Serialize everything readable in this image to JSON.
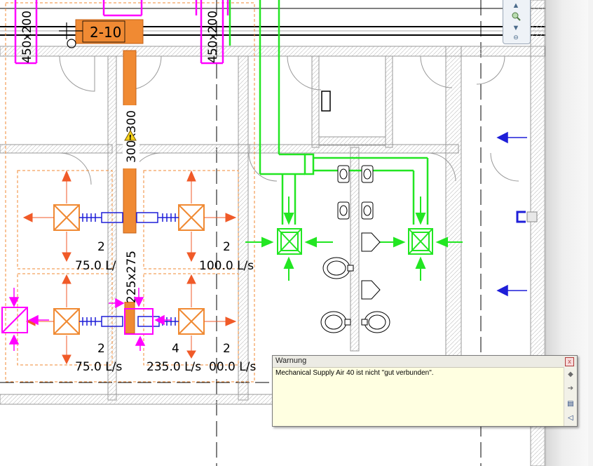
{
  "drawing": {
    "tag_room": "2-10",
    "duct_sizes": {
      "top_left": "450x200",
      "top_right": "450x200",
      "main_vertical": "300x300",
      "lower_vertical": "225x275"
    },
    "terminal_labels": [
      {
        "count": "2",
        "flow": "75.0 L/"
      },
      {
        "count": "2",
        "flow": "100.0 L/s"
      },
      {
        "count": "2",
        "flow": "75.0 L/s"
      },
      {
        "count": "4",
        "flow": "235.0 L/s"
      },
      {
        "count": "2",
        "flow": "00.0 L/s"
      }
    ],
    "warning_glyph": "!"
  },
  "nav_widget": {
    "up_icon": "arrow-up-icon",
    "zoom_icon": "zoom-icon",
    "down_icon": "arrow-down-icon"
  },
  "warning_dialog": {
    "title": "Warnung",
    "message": "Mechanical Supply Air 40 ist nicht \"gut verbunden\".",
    "close_label": "x",
    "tools": {
      "prev": "◆",
      "next": "➔",
      "expand": "▤",
      "export": "◁"
    }
  },
  "colors": {
    "duct_orange": "#f08a33",
    "supply_green": "#22e622",
    "return_magenta": "#ff00ff",
    "arrow_red": "#f05a28",
    "flow_blue": "#1f1fd8",
    "wall_gray": "#999999"
  }
}
